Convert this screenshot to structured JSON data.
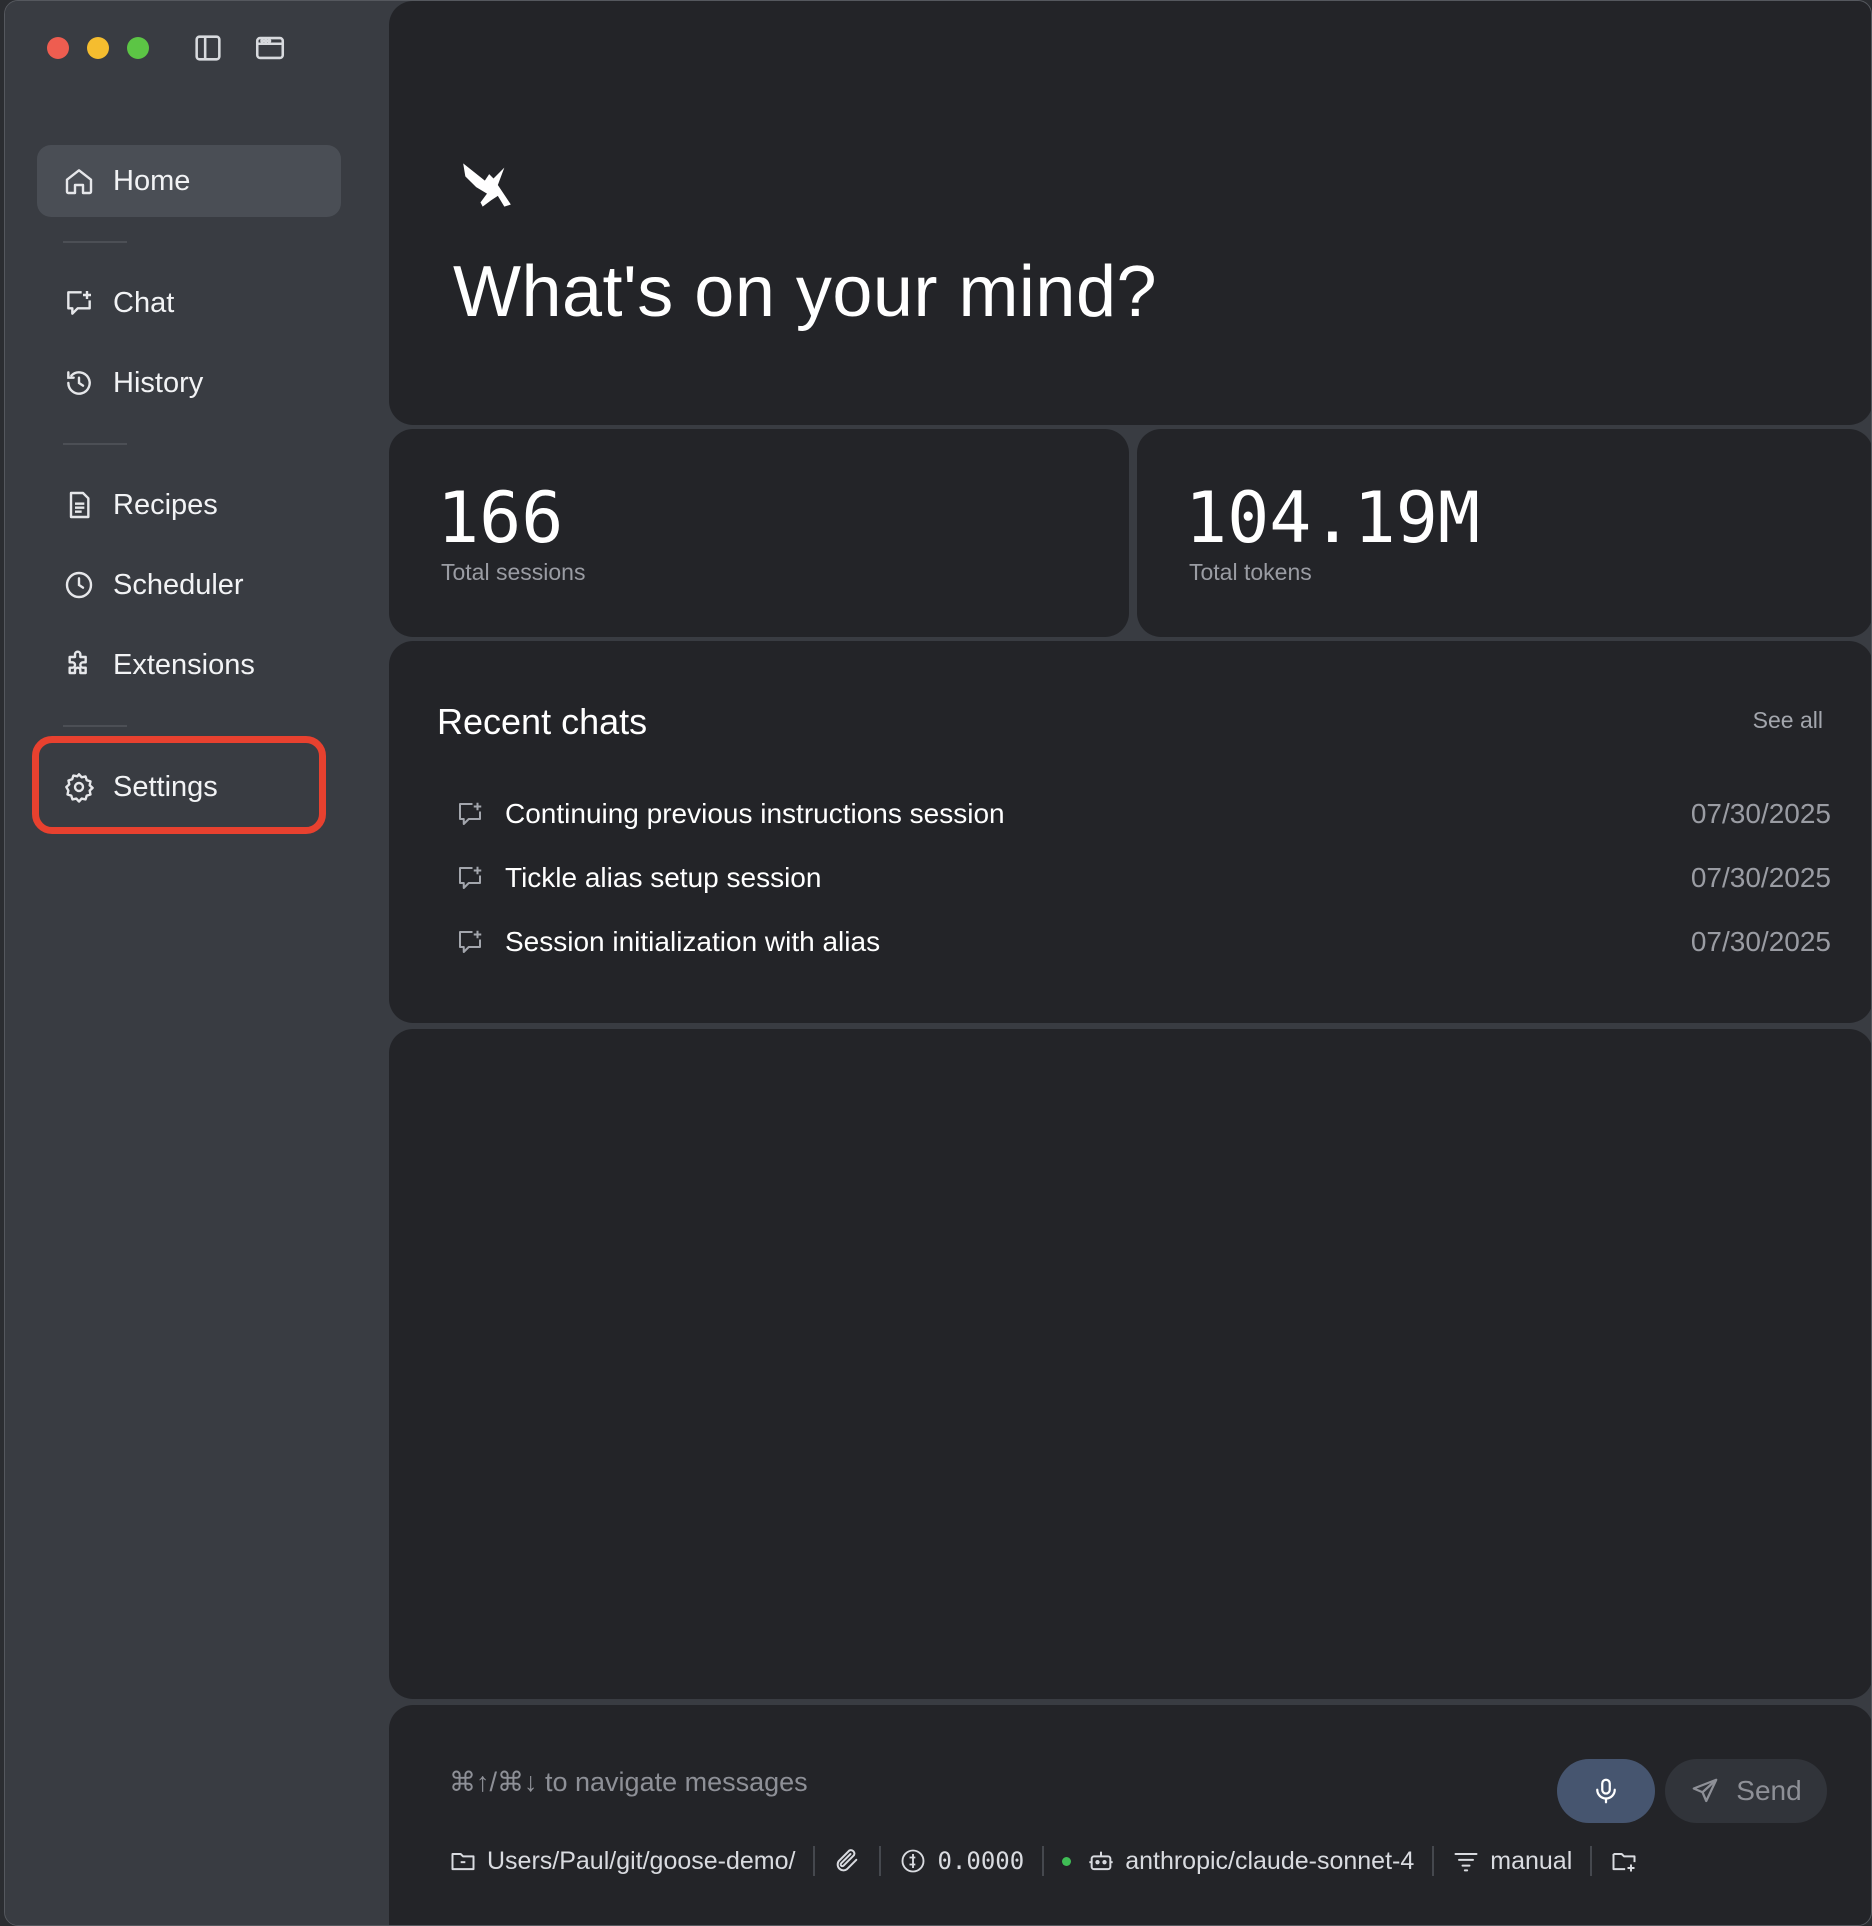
{
  "window": {
    "traffic_lights": {
      "close": "#ee5d50",
      "minimize": "#f5bd2f",
      "zoom": "#5cc545"
    }
  },
  "sidebar": {
    "items": [
      {
        "label": "Home",
        "icon": "home-icon",
        "active": true
      },
      {
        "label": "Chat",
        "icon": "chat-icon"
      },
      {
        "label": "History",
        "icon": "history-icon"
      },
      {
        "label": "Recipes",
        "icon": "recipe-icon"
      },
      {
        "label": "Scheduler",
        "icon": "clock-icon"
      },
      {
        "label": "Extensions",
        "icon": "puzzle-icon"
      },
      {
        "label": "Settings",
        "icon": "gear-icon",
        "highlighted": true
      }
    ],
    "highlight_color": "#e8412f"
  },
  "hero": {
    "title": "What's on your mind?"
  },
  "stats": [
    {
      "value": "166",
      "label": "Total sessions"
    },
    {
      "value": "104.19M",
      "label": "Total tokens"
    }
  ],
  "recent": {
    "title": "Recent chats",
    "see_all": "See all",
    "chats": [
      {
        "title": "Continuing previous instructions session",
        "date": "07/30/2025"
      },
      {
        "title": "Tickle alias setup session",
        "date": "07/30/2025"
      },
      {
        "title": "Session initialization with alias",
        "date": "07/30/2025"
      }
    ]
  },
  "composer": {
    "placeholder": "⌘↑/⌘↓ to navigate messages",
    "send_label": "Send",
    "directory": "Users/Paul/git/goose-demo/",
    "cost": "0.0000",
    "model": "anthropic/claude-sonnet-4",
    "mode": "manual",
    "status_color": "#3fbd55"
  }
}
